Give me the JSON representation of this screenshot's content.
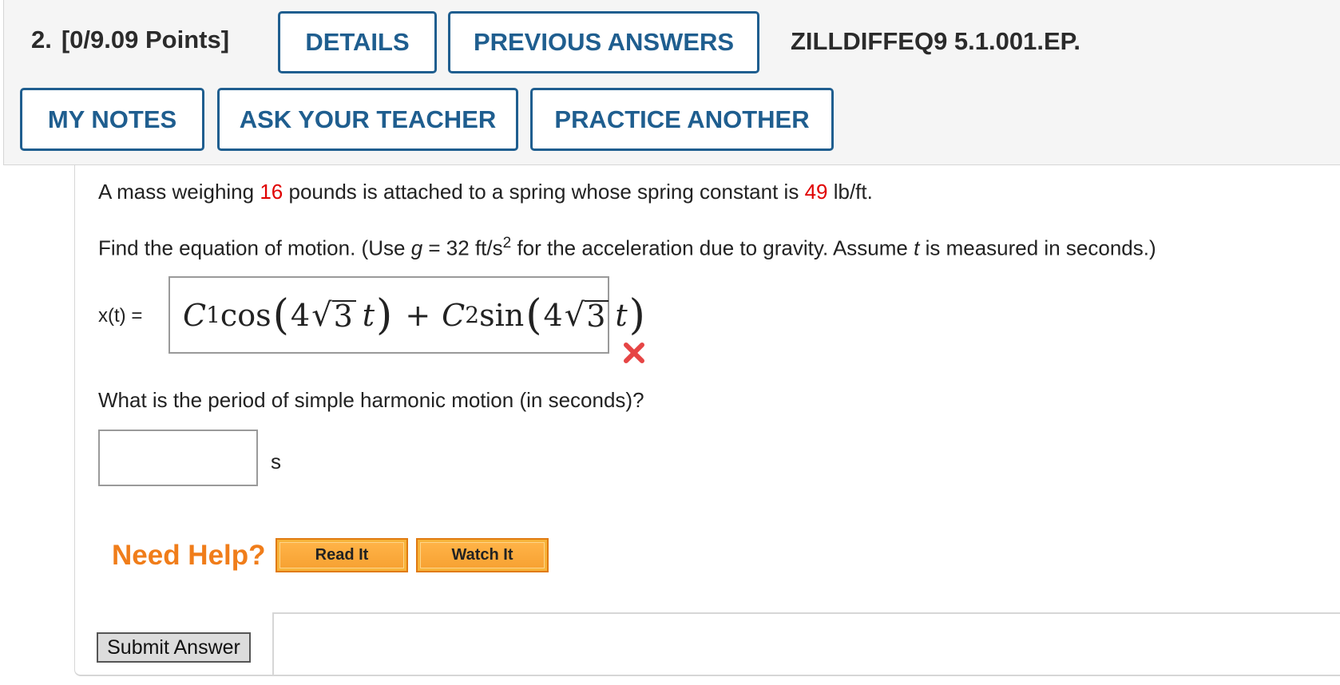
{
  "header": {
    "question_number": "2.",
    "points": "[0/9.09 Points]",
    "question_id": "ZILLDIFFEQ9 5.1.001.EP.",
    "buttons": {
      "details": "DETAILS",
      "previous_answers": "PREVIOUS ANSWERS",
      "my_notes": "MY NOTES",
      "ask_teacher": "ASK YOUR TEACHER",
      "practice_another": "PRACTICE ANOTHER"
    }
  },
  "problem": {
    "p1_before": "A mass weighing",
    "mass": "16",
    "p1_middle": "pounds is attached to a spring whose spring constant is",
    "spring_constant": "49",
    "p1_after": "lb/ft.",
    "p2_before": "Find the equation of motion. (Use",
    "p2_g": "g",
    "p2_middle": "= 32 ft/s",
    "p2_exp": "2",
    "p2_after1": "for the acceleration due to gravity. Assume",
    "p2_t": "t",
    "p2_after2": "is measured in seconds.)",
    "x_label": "x(t) =",
    "answer_math": {
      "c1": "C",
      "c1_sub": "1",
      "cos": "cos",
      "sin": "sin",
      "c2": "C",
      "c2_sub": "2",
      "coef": "4",
      "radicand": "3",
      "var": "t",
      "plus": "+"
    },
    "answer_status": "incorrect",
    "question2": "What is the period of simple harmonic motion (in seconds)?",
    "period_value": "",
    "period_unit": "s"
  },
  "help": {
    "label": "Need Help?",
    "read_it": "Read It",
    "watch_it": "Watch It"
  },
  "submit": {
    "label": "Submit Answer"
  },
  "colors": {
    "accent": "#1f5e8f",
    "red": "#e00000",
    "help_orange": "#f07d1a"
  }
}
